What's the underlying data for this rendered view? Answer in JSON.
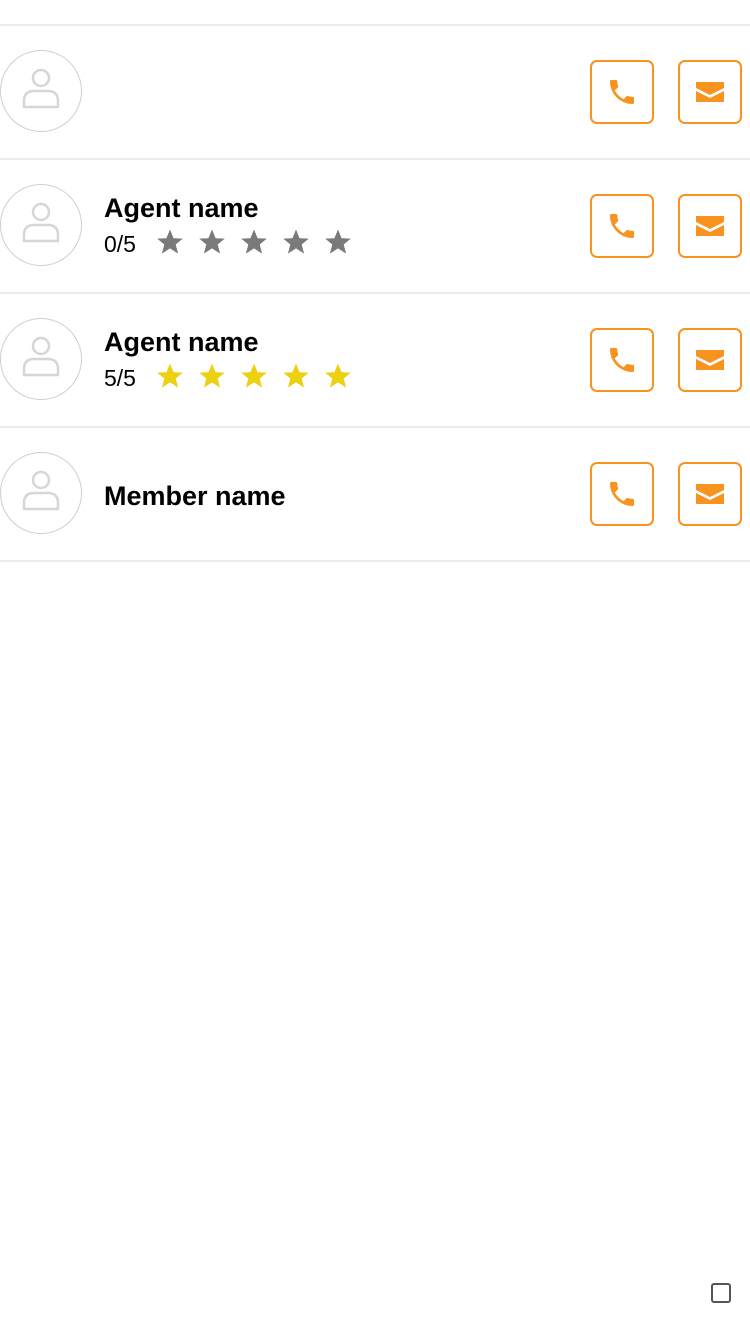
{
  "contacts": [
    {
      "name": "",
      "has_rating": false,
      "icons": {
        "avatar": "person-icon",
        "call": "phone-icon",
        "mail": "envelope-icon"
      }
    },
    {
      "name": "Agent name",
      "has_rating": true,
      "score": "0/5",
      "stars_filled": 0,
      "stars_total": 5,
      "icons": {
        "avatar": "person-icon",
        "call": "phone-icon",
        "mail": "envelope-icon"
      }
    },
    {
      "name": "Agent name",
      "has_rating": true,
      "score": "5/5",
      "stars_filled": 5,
      "stars_total": 5,
      "icons": {
        "avatar": "person-icon",
        "call": "phone-icon",
        "mail": "envelope-icon"
      }
    },
    {
      "name": "Member name",
      "has_rating": false,
      "icons": {
        "avatar": "person-icon",
        "call": "phone-icon",
        "mail": "envelope-icon"
      }
    }
  ],
  "colors": {
    "accent": "#f7931e",
    "star_filled": "#ecd112",
    "star_empty": "#7a7a7a",
    "divider": "#ececec",
    "avatar_border": "#cfcfcf",
    "avatar_glyph": "#d6d6d6"
  },
  "corner_icon": "square-icon"
}
